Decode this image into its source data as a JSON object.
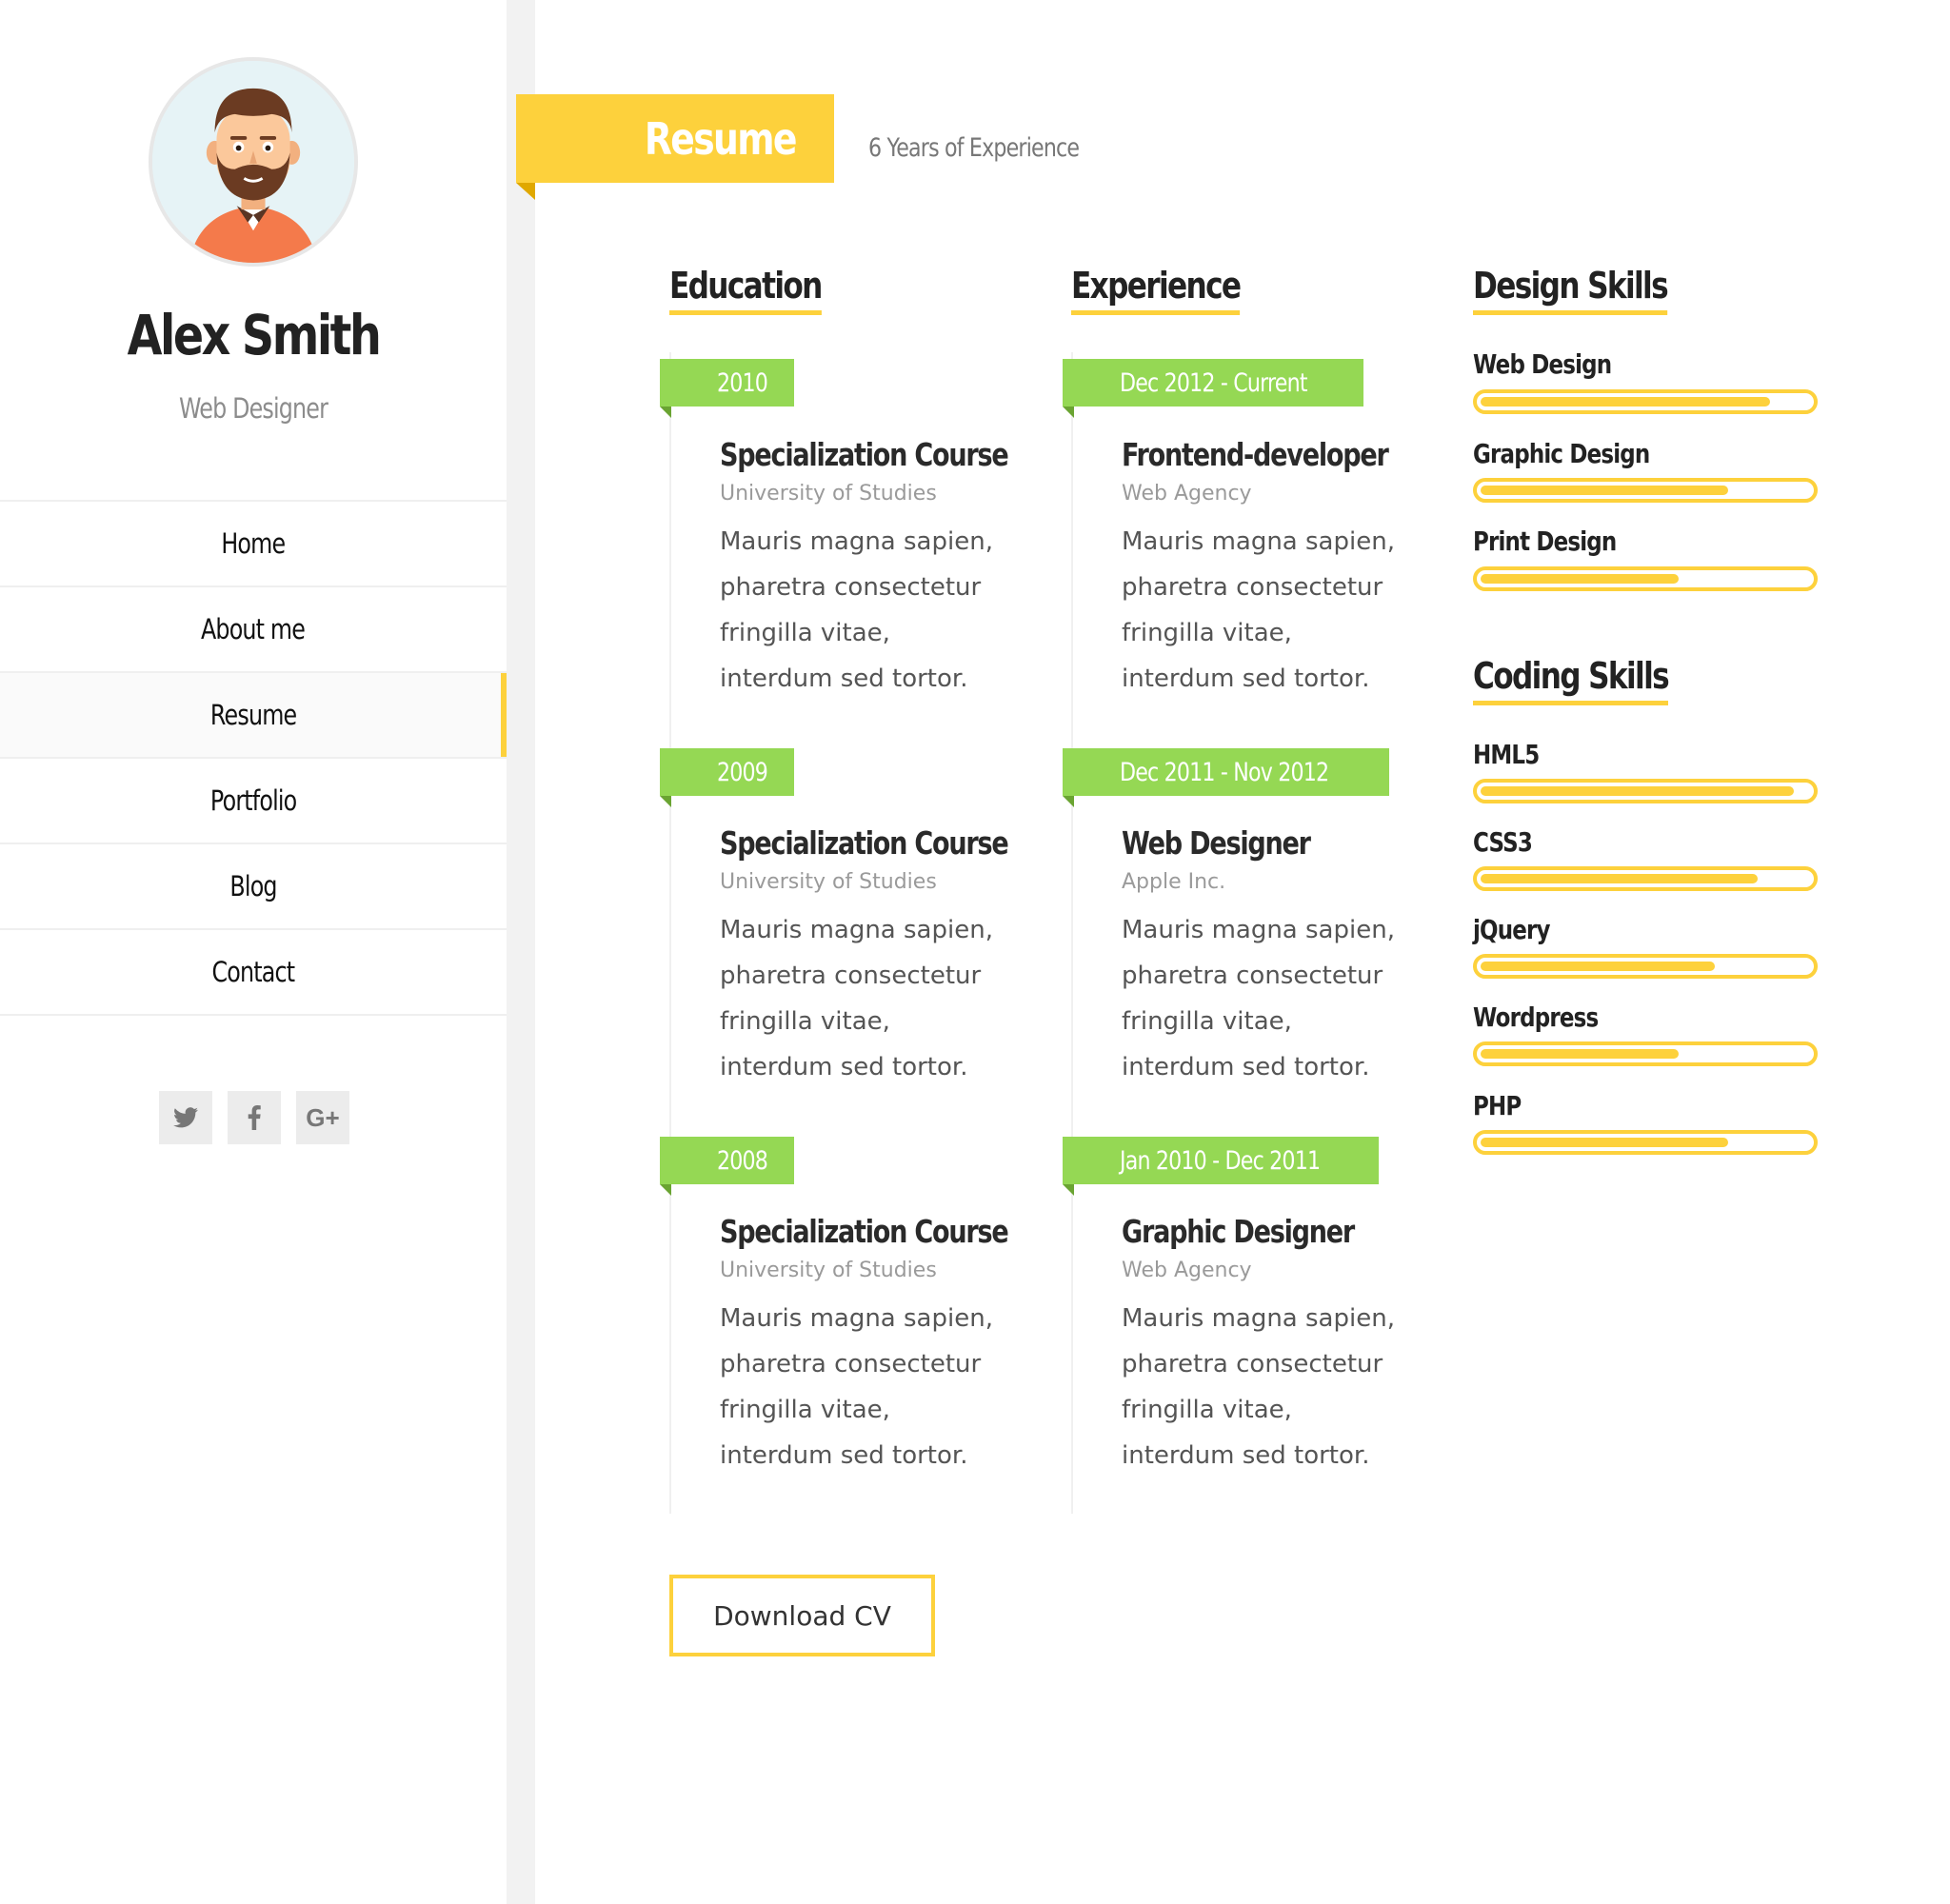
{
  "profile": {
    "name": "Alex Smith",
    "role": "Web Designer"
  },
  "nav": {
    "items": [
      {
        "label": "Home"
      },
      {
        "label": "About me"
      },
      {
        "label": "Resume"
      },
      {
        "label": "Portfolio"
      },
      {
        "label": "Blog"
      },
      {
        "label": "Contact"
      }
    ],
    "active": "Resume"
  },
  "social": {
    "icons": [
      "twitter-icon",
      "facebook-icon",
      "google-plus-icon"
    ],
    "google_plus_label": "G+"
  },
  "resume": {
    "title": "Resume",
    "subtitle": "6 Years of Experience"
  },
  "education": {
    "heading": "Education",
    "entries": [
      {
        "date": "2010",
        "title": "Specialization Course",
        "org": "University of Studies",
        "desc": "Mauris magna sapien, pharetra consectetur fringilla vitae, interdum sed tortor."
      },
      {
        "date": "2009",
        "title": "Specialization Course",
        "org": "University of Studies",
        "desc": "Mauris magna sapien, pharetra consectetur fringilla vitae, interdum sed tortor."
      },
      {
        "date": "2008",
        "title": "Specialization Course",
        "org": "University of Studies",
        "desc": "Mauris magna sapien, pharetra consectetur fringilla vitae, interdum sed tortor."
      }
    ]
  },
  "experience": {
    "heading": "Experience",
    "entries": [
      {
        "date": "Dec 2012 - Current",
        "title": "Frontend-developer",
        "org": "Web Agency",
        "desc": "Mauris magna sapien, pharetra consectetur fringilla vitae, interdum sed tortor."
      },
      {
        "date": "Dec 2011 - Nov 2012",
        "title": "Web Designer",
        "org": "Apple Inc.",
        "desc": "Mauris magna sapien, pharetra consectetur fringilla vitae, interdum sed tortor."
      },
      {
        "date": "Jan 2010 - Dec 2011",
        "title": "Graphic Designer",
        "org": "Web Agency",
        "desc": "Mauris magna sapien, pharetra consectetur fringilla vitae, interdum sed tortor."
      }
    ]
  },
  "design_skills": {
    "heading": "Design Skills",
    "items": [
      {
        "label": "Web Design",
        "level": 0.88
      },
      {
        "label": "Graphic Design",
        "level": 0.75
      },
      {
        "label": "Print Design",
        "level": 0.6
      }
    ]
  },
  "coding_skills": {
    "heading": "Coding Skills",
    "items": [
      {
        "label": "HML5",
        "level": 0.95
      },
      {
        "label": "CSS3",
        "level": 0.84
      },
      {
        "label": "jQuery",
        "level": 0.71
      },
      {
        "label": "Wordpress",
        "level": 0.6
      },
      {
        "label": "PHP",
        "level": 0.75
      }
    ]
  },
  "download": {
    "label": "Download CV"
  },
  "colors": {
    "accent": "#fdd13c",
    "date_tag": "#95d854",
    "avatar_bg": "#e6f3f6",
    "shirt": "#f47a4b"
  }
}
